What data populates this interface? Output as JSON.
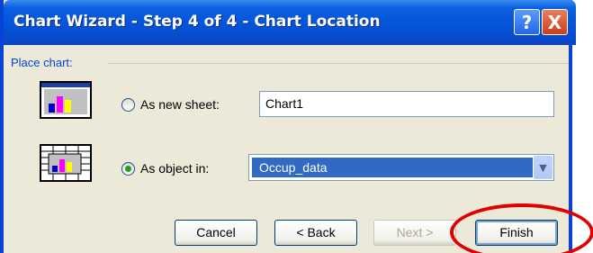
{
  "dialog": {
    "title": "Chart Wizard - Step 4 of 4 - Chart Location",
    "help_glyph": "?",
    "close_glyph": "X"
  },
  "place_chart": {
    "group_label": "Place chart:",
    "new_sheet": {
      "label": "As new sheet:",
      "value": "Chart1",
      "checked": false
    },
    "as_object": {
      "label": "As object in:",
      "value": "Occup_data",
      "checked": true
    }
  },
  "buttons": {
    "cancel": "Cancel",
    "back": "< Back",
    "next": "Next >",
    "finish": "Finish"
  },
  "colors": {
    "titlebar": "#0552d8",
    "dialog_bg": "#ece9d8",
    "selection": "#316ac5",
    "annotation": "#e00000"
  }
}
